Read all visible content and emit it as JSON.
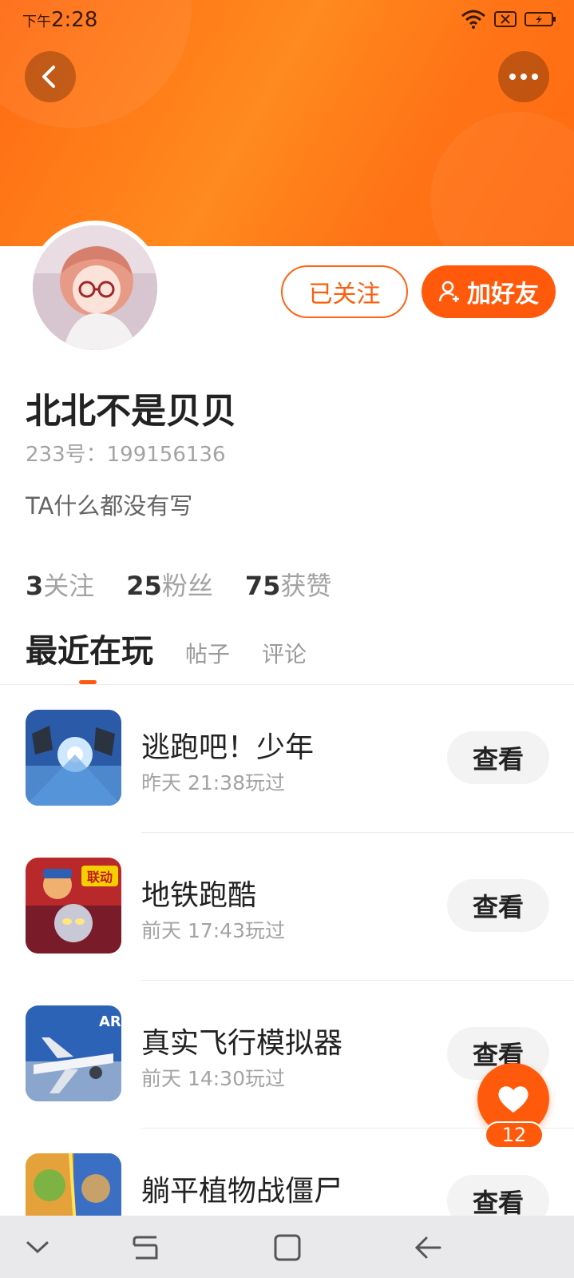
{
  "status_bar": {
    "time_prefix": "下午",
    "time": "2:28",
    "icons": [
      "wifi-icon",
      "sim-off-icon",
      "battery-icon"
    ]
  },
  "header": {
    "back_icon": "chevron-left-icon",
    "more_icon": "more-dots-icon",
    "accent_color": "#ff6a13"
  },
  "profile": {
    "name": "北北不是贝贝",
    "id_label": "233号：199156136",
    "bio": "TA什么都没有写",
    "follow_button": "已关注",
    "add_friend_button": "加好友",
    "stats": [
      {
        "num": "3",
        "label": "关注"
      },
      {
        "num": "25",
        "label": "粉丝"
      },
      {
        "num": "75",
        "label": "获赞"
      }
    ]
  },
  "tabs": {
    "active": "最近在玩",
    "items": [
      "帖子",
      "评论"
    ]
  },
  "games": [
    {
      "title": "逃跑吧！少年",
      "time": "昨天 21:38玩过",
      "button": "查看"
    },
    {
      "title": "地铁跑酷",
      "time": "前天 17:43玩过",
      "button": "查看"
    },
    {
      "title": "真实飞行模拟器",
      "time": "前天 14:30玩过",
      "button": "查看"
    },
    {
      "title": "躺平植物战僵尸",
      "time": "",
      "button": "查看"
    }
  ],
  "fab": {
    "icon": "heart-icon",
    "count": "12"
  },
  "nav_bar": {
    "icons": [
      "chevron-down-icon",
      "recent-apps-icon",
      "home-icon",
      "back-arrow-icon"
    ]
  }
}
